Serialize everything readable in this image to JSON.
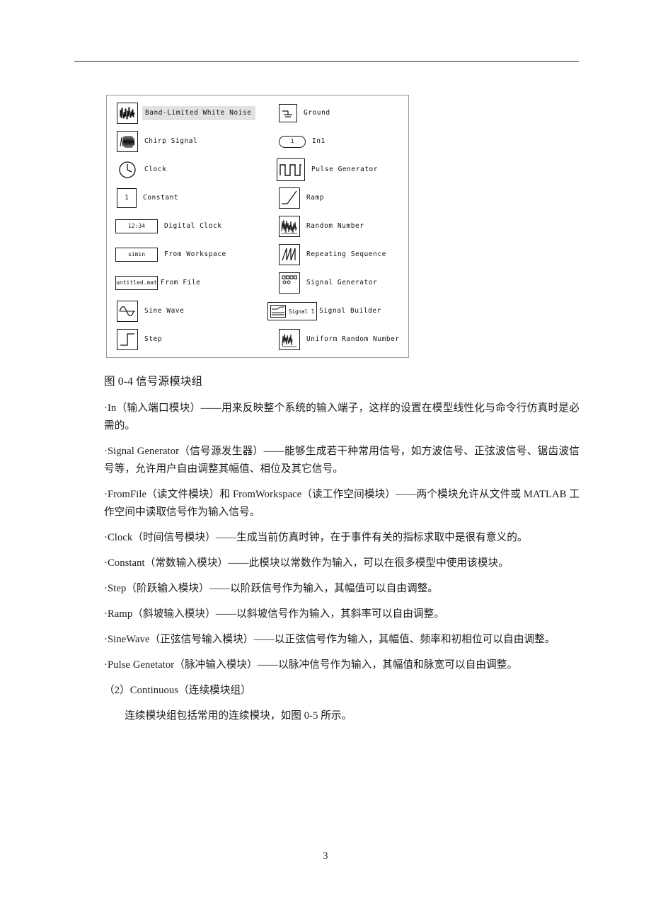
{
  "page": {
    "number": "3"
  },
  "figure": {
    "caption": "图 0-4 信号源模块组",
    "left_column": [
      {
        "label": "Band-Limited White Noise",
        "icon": "noise-waveform-icon",
        "selected": true
      },
      {
        "label": "Chirp Signal",
        "icon": "chirp-waveform-icon",
        "selected": false
      },
      {
        "label": "Clock",
        "icon": "clock-icon",
        "selected": false
      },
      {
        "label": "Constant",
        "icon": "constant-icon",
        "value": "1",
        "selected": false
      },
      {
        "label": "Digital Clock",
        "icon": "digital-clock-icon",
        "value": "12:34",
        "selected": false
      },
      {
        "label": "From Workspace",
        "icon": "from-workspace-icon",
        "value": "simin",
        "selected": false
      },
      {
        "label": "From File",
        "icon": "from-file-icon",
        "value": "untitled.mat",
        "selected": false
      },
      {
        "label": "Sine Wave",
        "icon": "sine-wave-icon",
        "selected": false
      },
      {
        "label": "Step",
        "icon": "step-icon",
        "selected": false
      }
    ],
    "right_column": [
      {
        "label": "Ground",
        "icon": "ground-icon"
      },
      {
        "label": "In1",
        "icon": "inport-icon",
        "value": "1"
      },
      {
        "label": "Pulse Generator",
        "icon": "pulse-generator-icon"
      },
      {
        "label": "Ramp",
        "icon": "ramp-icon"
      },
      {
        "label": "Random Number",
        "icon": "random-number-icon"
      },
      {
        "label": "Repeating Sequence",
        "icon": "repeating-sequence-icon"
      },
      {
        "label": "Signal Generator",
        "icon": "signal-generator-icon"
      },
      {
        "label": "Signal Builder",
        "icon": "signal-builder-icon",
        "value": "Signal 1"
      },
      {
        "label": "Uniform Random Number",
        "icon": "uniform-random-number-icon"
      }
    ]
  },
  "body": {
    "paragraphs": [
      "·In（输入端口模块）——用来反映整个系统的输入端子，这样的设置在模型线性化与命令行仿真时是必需的。",
      "·Signal Generator（信号源发生器）——能够生成若干种常用信号，如方波信号、正弦波信号、锯齿波信号等，允许用户自由调整其幅值、相位及其它信号。",
      "·FromFile（读文件模块）和 FromWorkspace（读工作空间模块）——两个模块允许从文件或 MATLAB 工作空间中读取信号作为输入信号。",
      "·Clock（时间信号模块）——生成当前仿真时钟，在于事件有关的指标求取中是很有意义的。",
      "·Constant（常数输入模块）——此模块以常数作为输入，可以在很多模型中使用该模块。",
      "·Step（阶跃输入模块）——以阶跃信号作为输入，其幅值可以自由调整。",
      "·Ramp（斜坡输入模块）——以斜坡信号作为输入，其斜率可以自由调整。",
      "·SineWave（正弦信号输入模块）——以正弦信号作为输入，其幅值、频率和初相位可以自由调整。",
      "·Pulse Genetator（脉冲输入模块）——以脉冲信号作为输入，其幅值和脉宽可以自由调整。",
      "（2）Continuous（连续模块组）"
    ],
    "closing_paragraph": "连续模块组包括常用的连续模块，如图 0-5 所示。"
  }
}
